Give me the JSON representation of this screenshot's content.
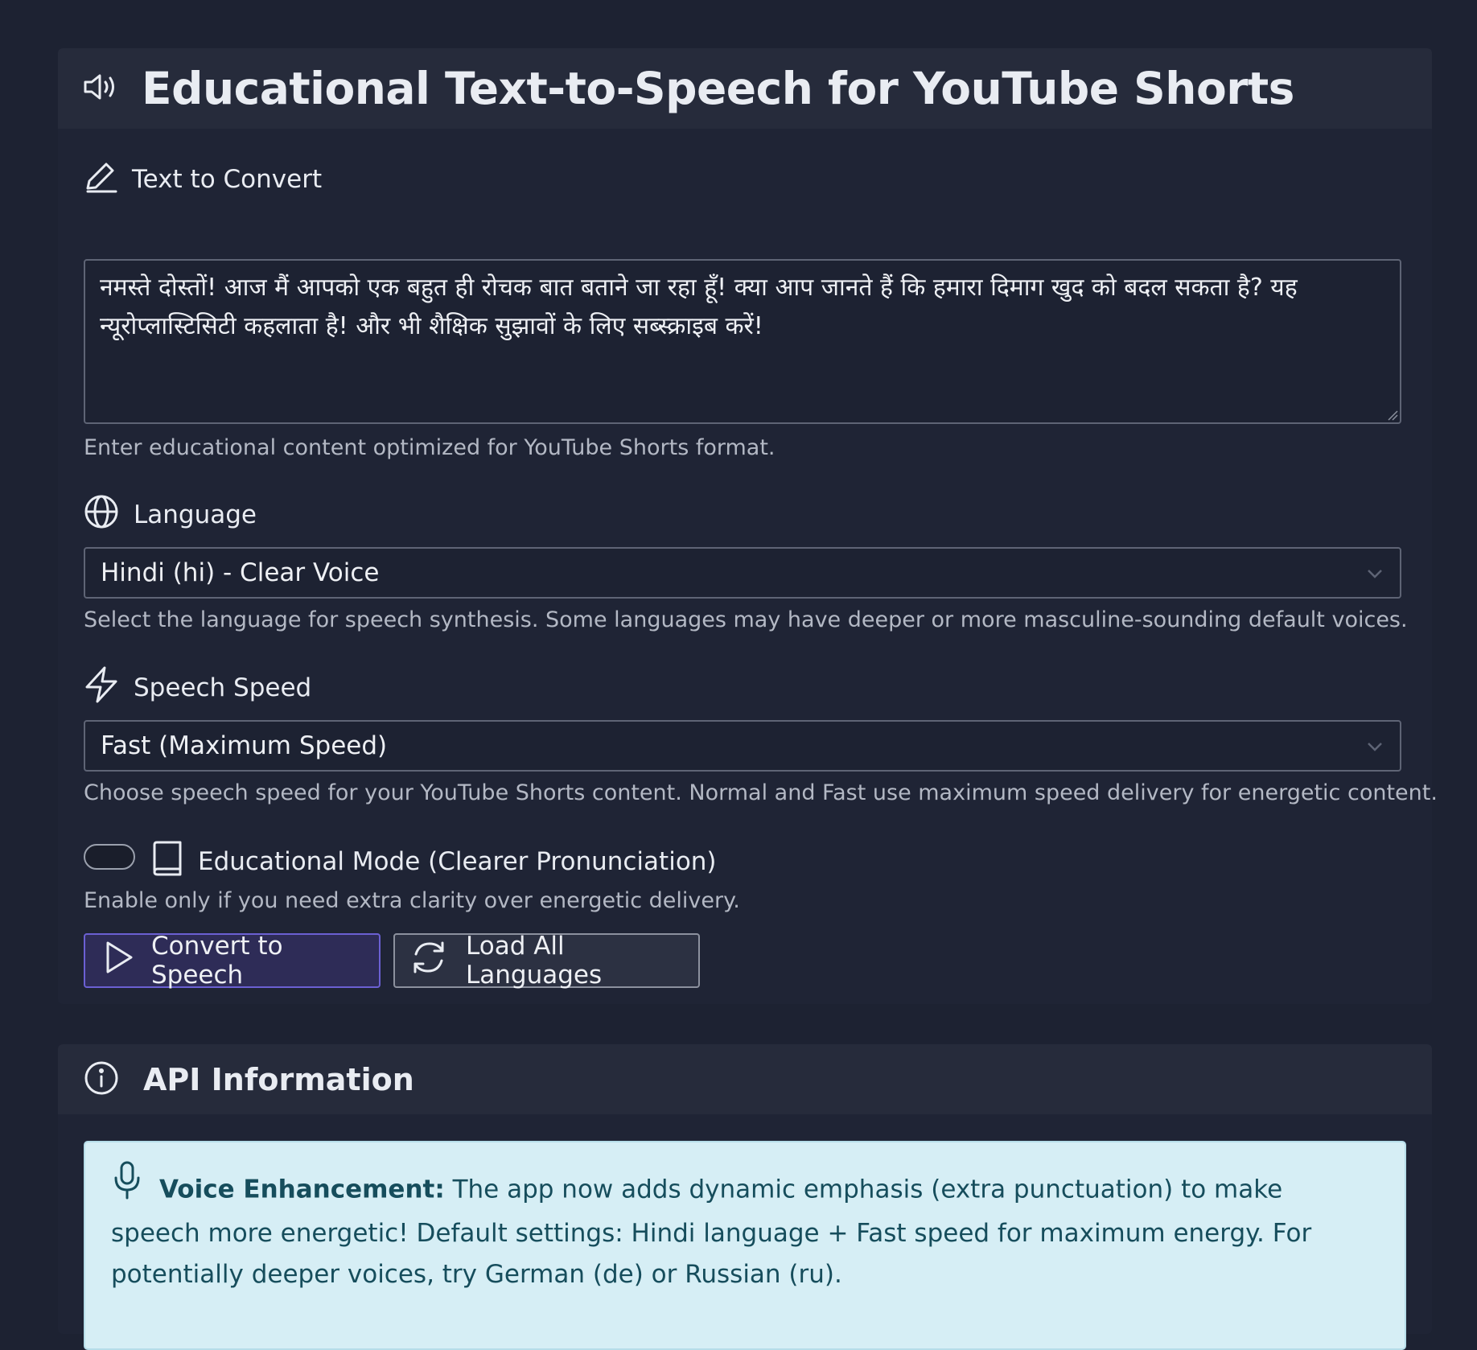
{
  "header": {
    "title": "Educational Text-to-Speech for YouTube Shorts",
    "icon": "speaker-icon"
  },
  "text_field": {
    "label": "Text to Convert",
    "icon": "pencil-icon",
    "value": "नमस्ते दोस्तों! आज मैं आपको एक बहुत ही रोचक बात बताने जा रहा हूँ! क्या आप जानते हैं कि हमारा दिमाग खुद को बदल सकता है? यह न्यूरोप्लास्टिसिटी कहलाता है! और भी शैक्षिक सुझावों के लिए सब्स्क्राइब करें!",
    "help": "Enter educational content optimized for YouTube Shorts format."
  },
  "language": {
    "label": "Language",
    "icon": "globe-icon",
    "selected": "Hindi (hi) - Clear Voice",
    "help": "Select the language for speech synthesis. Some languages may have deeper or more masculine-sounding default voices."
  },
  "speed": {
    "label": "Speech Speed",
    "icon": "lightning-icon",
    "selected": "Fast (Maximum Speed)",
    "help": "Choose speech speed for your YouTube Shorts content. Normal and Fast use maximum speed delivery for energetic content."
  },
  "educational_mode": {
    "label": "Educational Mode (Clearer Pronunciation)",
    "icon": "book-icon",
    "enabled": false,
    "help": "Enable only if you need extra clarity over energetic delivery."
  },
  "buttons": {
    "convert": "Convert to Speech",
    "load_languages": "Load All Languages"
  },
  "api_info": {
    "title": "API Information",
    "icon": "info-icon",
    "alert_icon": "microphone-icon",
    "alert_strong": "Voice Enhancement:",
    "alert_text": " The app now adds dynamic emphasis (extra punctuation) to make speech more energetic! Default settings: Hindi language + Fast speed for maximum energy. For potentially deeper voices, try German (de) or Russian (ru)."
  },
  "colors": {
    "background": "#1d2232",
    "primary_border": "#6b60d3",
    "alert_bg": "#d6eef5",
    "alert_text": "#164d5c"
  }
}
